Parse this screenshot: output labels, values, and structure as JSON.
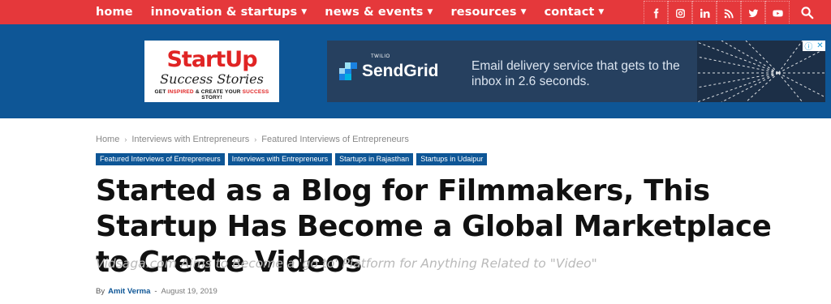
{
  "nav": {
    "items": [
      {
        "label": "home",
        "has_dropdown": false
      },
      {
        "label": "innovation & startups",
        "has_dropdown": true
      },
      {
        "label": "news & events",
        "has_dropdown": true
      },
      {
        "label": "resources",
        "has_dropdown": true
      },
      {
        "label": "contact",
        "has_dropdown": true
      }
    ],
    "dropdown_glyph": "⌄",
    "socials": [
      "facebook-icon",
      "instagram-icon",
      "linkedin-icon",
      "rss-icon",
      "twitter-icon",
      "youtube-icon"
    ],
    "search_icon": "search-icon"
  },
  "colors": {
    "nav_red": "#e5383b",
    "header_blue": "#0e5696",
    "ad_bg": "#26405f",
    "link_blue": "#0e5696"
  },
  "logo": {
    "line1_start": "Start",
    "line1_end": "Up",
    "line2": "Success Stories",
    "line3_a": "GET ",
    "line3_b": "INSPIRED",
    "line3_c": " & CREATE YOUR ",
    "line3_d": "SUCCESS",
    "line3_e": " STORY!"
  },
  "ad": {
    "brand_small": "TWILIO",
    "brand": "SendGrid",
    "copy": "Email delivery service that gets to the inbox in 2.6 seconds."
  },
  "breadcrumb": {
    "items": [
      "Home",
      "Interviews with Entrepreneurs",
      "Featured Interviews of Entrepreneurs"
    ],
    "separator": "›"
  },
  "tags": [
    "Featured Interviews of Entrepreneurs",
    "Interviews with Entrepreneurs",
    "Startups in Rajasthan",
    "Startups in Udaipur"
  ],
  "article": {
    "title": "Started as a Blog for Filmmakers, This Startup Has Become a Global Marketplace to Create Videos",
    "subtitle": "Vidsaga.com Aims to Become a 'go to' Platform for Anything Related to \"Video\"",
    "by_label": "By",
    "author": "Amit Verma",
    "dash": "-",
    "date": "August 19, 2019"
  }
}
